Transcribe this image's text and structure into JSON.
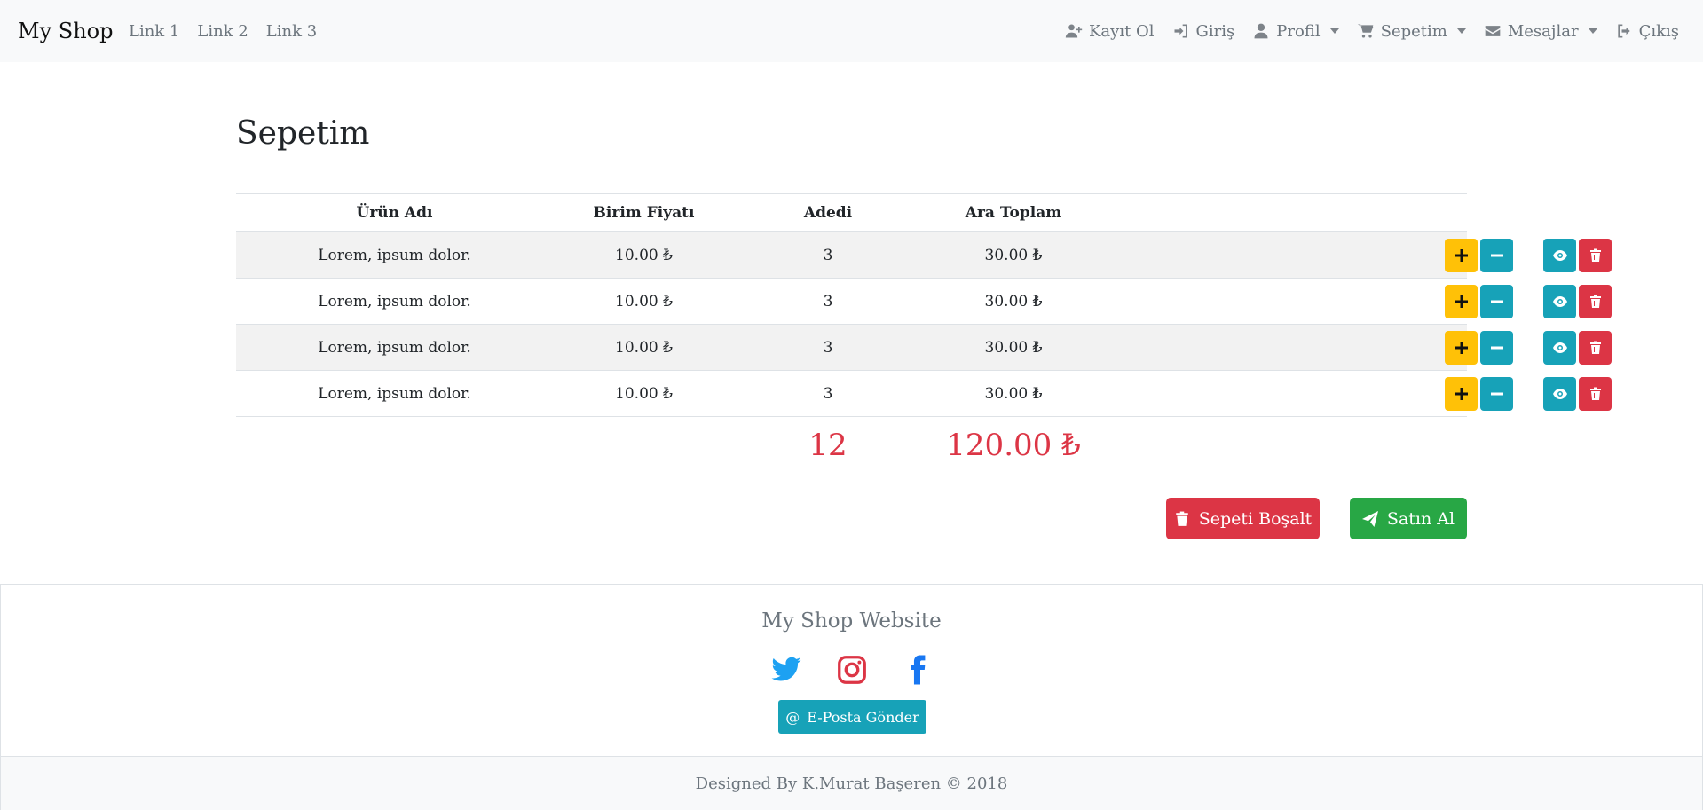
{
  "navbar": {
    "brand": "My Shop",
    "links": [
      "Link 1",
      "Link 2",
      "Link 3"
    ],
    "right": [
      {
        "label": "Kayıt Ol",
        "icon": "user-plus-icon"
      },
      {
        "label": "Giriş",
        "icon": "sign-in-icon"
      },
      {
        "label": "Profil",
        "icon": "user-icon",
        "dropdown": true
      },
      {
        "label": "Sepetim",
        "icon": "cart-icon",
        "dropdown": true
      },
      {
        "label": "Mesajlar",
        "icon": "envelope-icon",
        "dropdown": true
      },
      {
        "label": "Çıkış",
        "icon": "sign-out-icon"
      }
    ]
  },
  "page": {
    "title": "Sepetim"
  },
  "table": {
    "headers": [
      "Ürün Adı",
      "Birim Fiyatı",
      "Adedi",
      "Ara Toplam"
    ],
    "rows": [
      {
        "name": "Lorem, ipsum dolor.",
        "price": "10.00 ₺",
        "qty": "3",
        "subtotal": "30.00 ₺"
      },
      {
        "name": "Lorem, ipsum dolor.",
        "price": "10.00 ₺",
        "qty": "3",
        "subtotal": "30.00 ₺"
      },
      {
        "name": "Lorem, ipsum dolor.",
        "price": "10.00 ₺",
        "qty": "3",
        "subtotal": "30.00 ₺"
      },
      {
        "name": "Lorem, ipsum dolor.",
        "price": "10.00 ₺",
        "qty": "3",
        "subtotal": "30.00 ₺"
      }
    ],
    "total_qty": "12",
    "total_sum": "120.00 ₺"
  },
  "actions": {
    "empty_label": "Sepeti Boşalt",
    "buy_label": "Satın Al"
  },
  "footer": {
    "title": "My Shop Website",
    "email_label": "E-Posta Gönder",
    "copyright": "Designed By K.Murat Başeren © 2018"
  },
  "colors": {
    "warning": "#ffc107",
    "info": "#17a2b8",
    "danger": "#dc3545",
    "success": "#28a745",
    "twitter": "#1da1f2",
    "instagram": "#dc3545",
    "facebook": "#1877f2"
  }
}
